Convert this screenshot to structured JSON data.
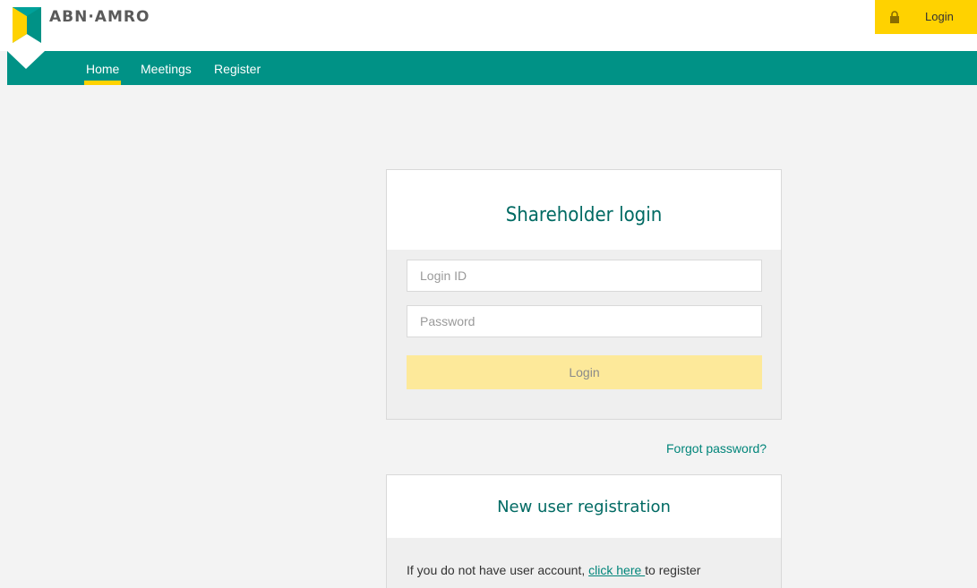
{
  "header": {
    "brand": "ABN·AMRO",
    "login_label": "Login",
    "colors": {
      "yellow": "#ffd200",
      "green": "#009286",
      "dark_green": "#006a63"
    }
  },
  "nav": {
    "items": [
      {
        "label": "Home",
        "active": true
      },
      {
        "label": "Meetings",
        "active": false
      },
      {
        "label": "Register",
        "active": false
      }
    ]
  },
  "login_card": {
    "title": "Shareholder login",
    "login_id_placeholder": "Login ID",
    "password_placeholder": "Password",
    "button_label": "Login"
  },
  "forgot_password": "Forgot password?",
  "registration_card": {
    "title": "New user registration",
    "text_before": "If you do not have user account, ",
    "link_text": "click here ",
    "text_after": "to register"
  },
  "icons": {
    "logo": "abn-amro-shield-icon",
    "lock": "lock-icon"
  }
}
